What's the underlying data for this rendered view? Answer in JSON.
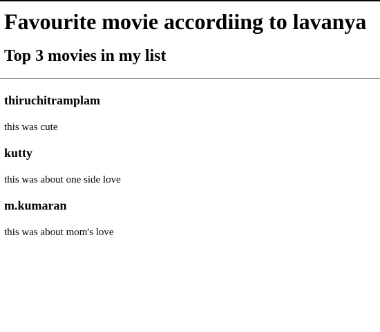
{
  "page": {
    "title": "Favourite movie accordiing to lavanya",
    "subtitle": "Top 3 movies in my list"
  },
  "movies": [
    {
      "title": "thiruchitramplam",
      "description": "this was cute"
    },
    {
      "title": "kutty",
      "description": "this was about one side love"
    },
    {
      "title": "m.kumaran",
      "description": "this was about mom's love"
    }
  ]
}
